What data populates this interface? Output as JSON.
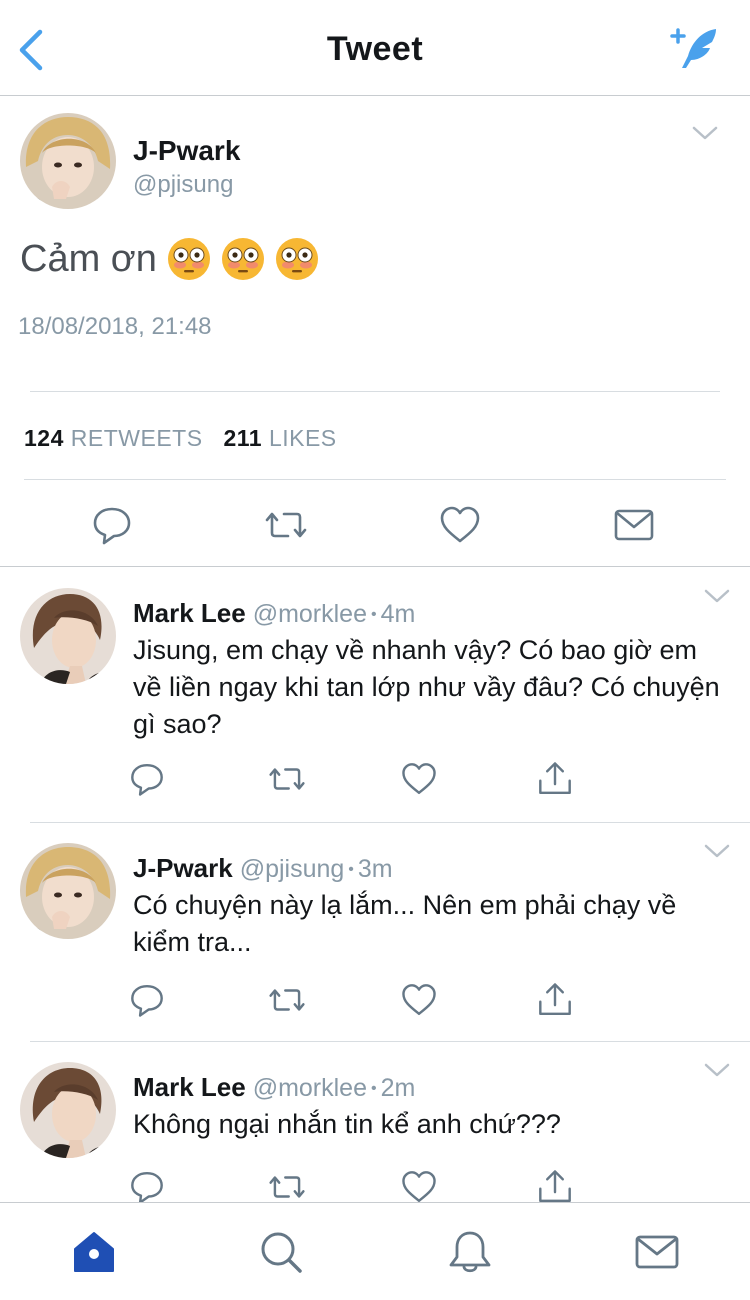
{
  "header": {
    "title": "Tweet",
    "back_icon": "chevron-left-icon",
    "compose_icon": "compose-tweet-icon",
    "accent_color": "#4aa1ec"
  },
  "main_tweet": {
    "name": "J-Pwark",
    "handle": "@pjisung",
    "text": "Cảm ơn",
    "emoji": [
      "flushed-face-emoji",
      "flushed-face-emoji",
      "flushed-face-emoji"
    ],
    "date": "18/08/2018, 21:48",
    "retweets_count": "124",
    "retweets_label": "RETWEETS",
    "likes_count": "211",
    "likes_label": "LIKES"
  },
  "replies": [
    {
      "name": "Mark Lee",
      "handle": "@morklee",
      "separator": "•",
      "time": "4m",
      "text": "Jisung, em chạy về nhanh vậy? Có bao giờ em về liền ngay khi tan lớp như vầy đâu? Có chuyện gì sao?"
    },
    {
      "name": "J-Pwark",
      "handle": "@pjisung",
      "separator": "•",
      "time": "3m",
      "text": "Có chuyện này lạ lắm... Nên em phải chạy về kiểm tra..."
    },
    {
      "name": "Mark Lee",
      "handle": "@morklee",
      "separator": "•",
      "time": "2m",
      "text": "Không ngại nhắn tin kể anh chứ???"
    }
  ],
  "tabbar": {
    "items": [
      "home-icon",
      "search-icon",
      "notifications-icon",
      "messages-icon"
    ],
    "active_color": "#1f4fb4"
  }
}
